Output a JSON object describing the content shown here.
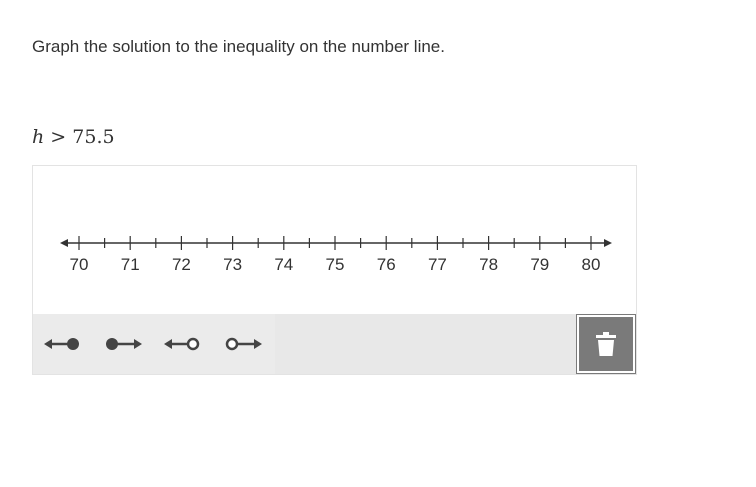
{
  "question": {
    "prompt": "Graph the solution to the inequality on the number line.",
    "inequality": {
      "variable": "h",
      "operator": ">",
      "value": "75.5"
    }
  },
  "number_line": {
    "min": 70,
    "max": 80,
    "major_step": 1,
    "minor_step": 0.5,
    "labels": [
      "70",
      "71",
      "72",
      "73",
      "74",
      "75",
      "76",
      "77",
      "78",
      "79",
      "80"
    ],
    "line_color": "#333333"
  },
  "toolbar": {
    "tools": [
      {
        "name": "closed-left-ray",
        "icon": "closed-circle-left-arrow-icon"
      },
      {
        "name": "closed-right-ray",
        "icon": "closed-circle-right-arrow-icon"
      },
      {
        "name": "open-left-ray",
        "icon": "open-circle-left-arrow-icon"
      },
      {
        "name": "open-right-ray",
        "icon": "open-circle-right-arrow-icon"
      }
    ],
    "delete_icon": "trash-icon",
    "background": "#e8e8e8",
    "delete_color": "#7a7a7a"
  }
}
